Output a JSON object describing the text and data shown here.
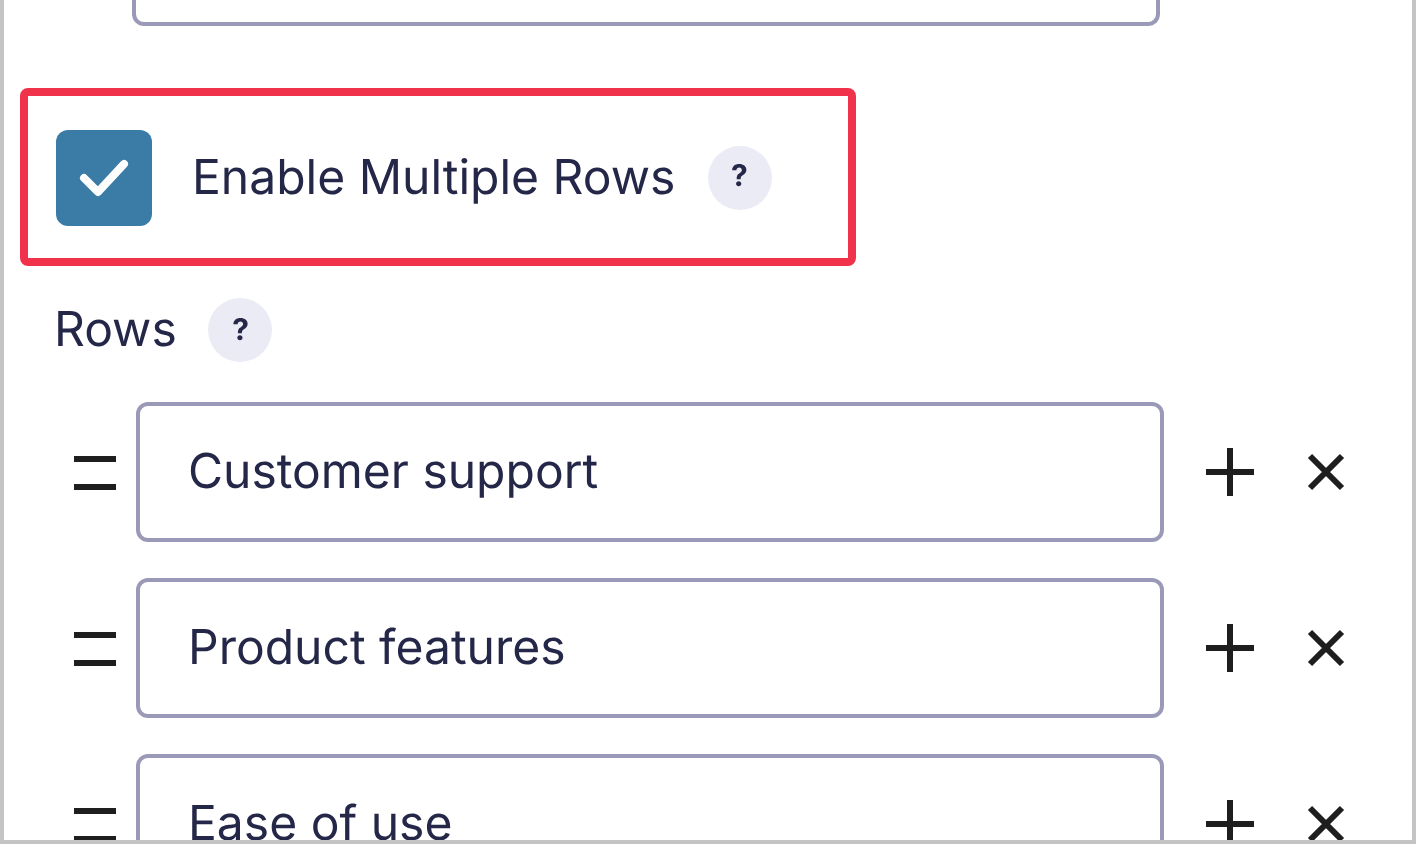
{
  "enable_option": {
    "label": "Enable Multiple Rows",
    "checked": true,
    "help": "?"
  },
  "rows_section": {
    "label": "Rows",
    "help": "?",
    "rows": [
      {
        "value": "Customer support"
      },
      {
        "value": "Product features"
      },
      {
        "value": "Ease of use"
      }
    ]
  }
}
